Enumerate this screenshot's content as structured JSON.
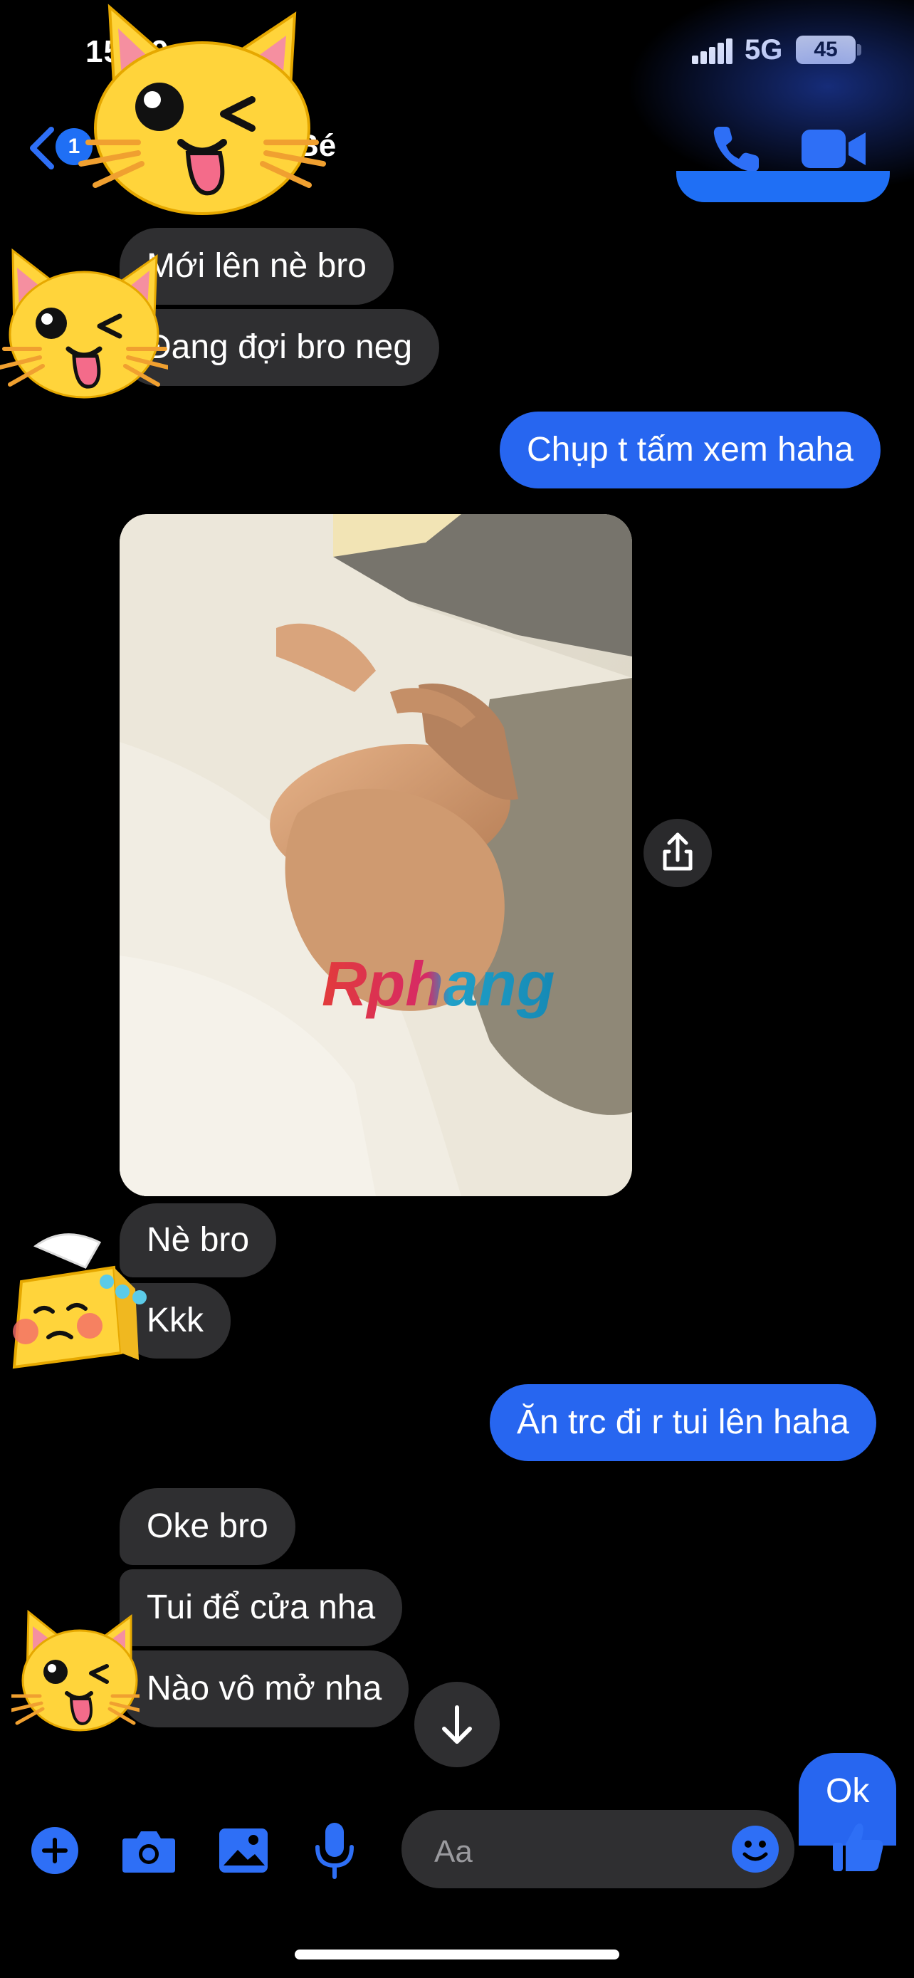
{
  "status_bar": {
    "time": "15:19",
    "network": "5G",
    "battery": "45"
  },
  "header": {
    "back_badge": "1",
    "contact_name": "Bé"
  },
  "colors": {
    "accent": "#2766f0",
    "incoming_bubble": "#2f2f31",
    "background": "#000000"
  },
  "messages": [
    {
      "side": "incoming",
      "text": "Mới lên nè bro"
    },
    {
      "side": "incoming",
      "text": "Đang đợi bro neg"
    },
    {
      "side": "outgoing",
      "text": "Chụp t tấm xem haha"
    },
    {
      "side": "incoming",
      "type": "photo"
    },
    {
      "side": "incoming",
      "text": "Nè bro"
    },
    {
      "side": "incoming",
      "text": "Kkk"
    },
    {
      "side": "outgoing",
      "text": "Ăn trc đi r tui lên haha"
    },
    {
      "side": "incoming",
      "text": "Oke bro"
    },
    {
      "side": "incoming",
      "text": "Tui để cửa nha"
    },
    {
      "side": "incoming",
      "text": "Nào vô mở nha"
    },
    {
      "side": "outgoing",
      "text": "Ok"
    }
  ],
  "photo": {
    "watermark": "Rphang"
  },
  "composer": {
    "placeholder": "Aa"
  },
  "icons": {
    "header": [
      "back-chevron-icon",
      "phone-icon",
      "video-camera-icon"
    ],
    "composer": [
      "plus-icon",
      "camera-icon",
      "gallery-icon",
      "microphone-icon",
      "emoji-icon",
      "thumbs-up-icon"
    ],
    "stickers": [
      "cat-wink-sticker",
      "tofu-crying-sticker"
    ],
    "chat": [
      "share-icon",
      "arrow-down-icon"
    ]
  }
}
